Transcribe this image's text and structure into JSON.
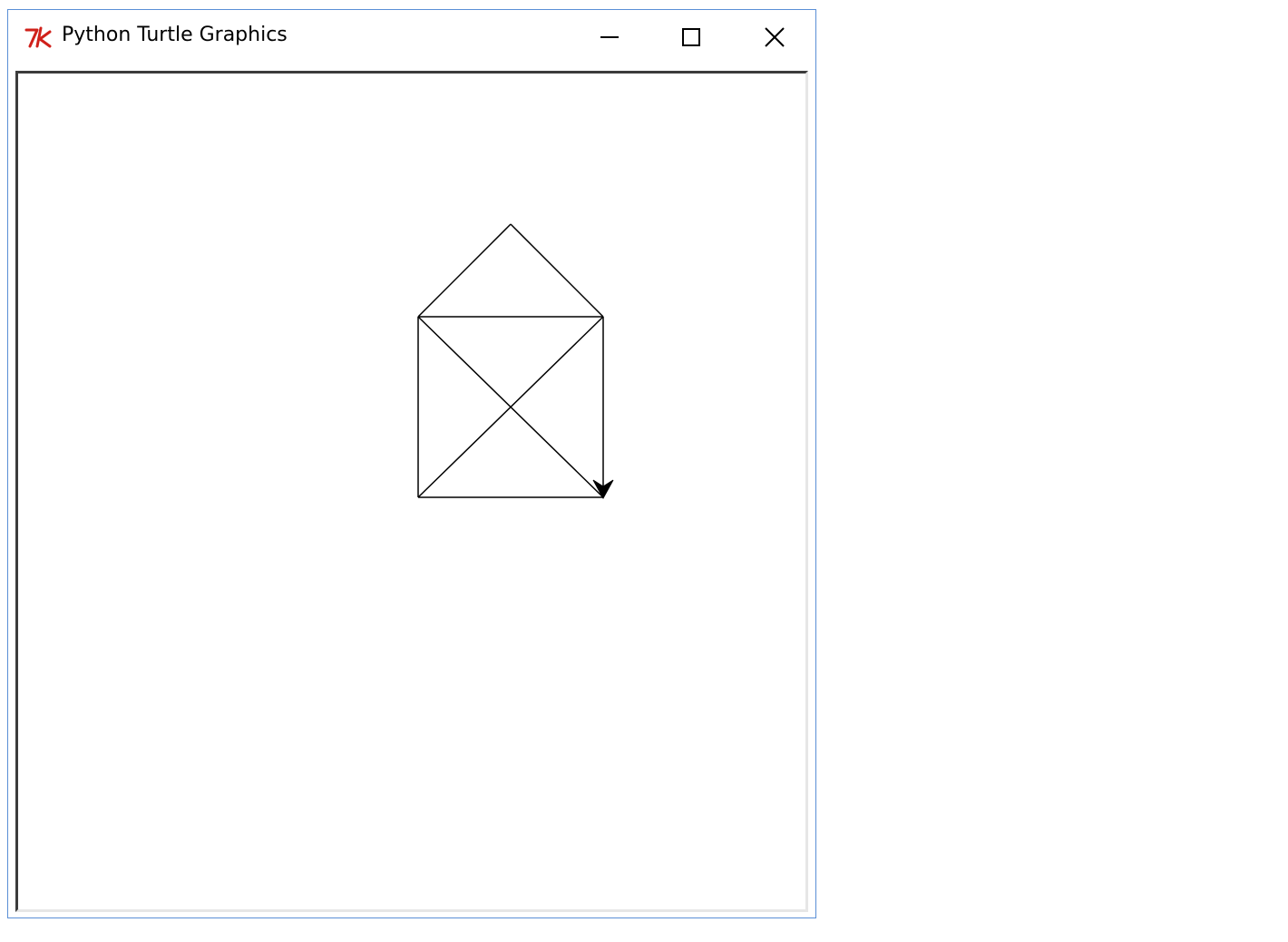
{
  "window": {
    "title": "Python Turtle Graphics",
    "app_icon": "tk-feather-icon",
    "controls": {
      "minimize_icon": "minimize-icon",
      "maximize_icon": "maximize-icon",
      "close_icon": "close-icon"
    },
    "colors": {
      "border": "#5a8fd6",
      "icon_red": "#d0201a",
      "line": "#000000"
    }
  },
  "canvas": {
    "background": "#ffffff",
    "drawing": "house-of-santa-claus",
    "turtle_heading": "down",
    "turtle_shape": "arrow"
  }
}
